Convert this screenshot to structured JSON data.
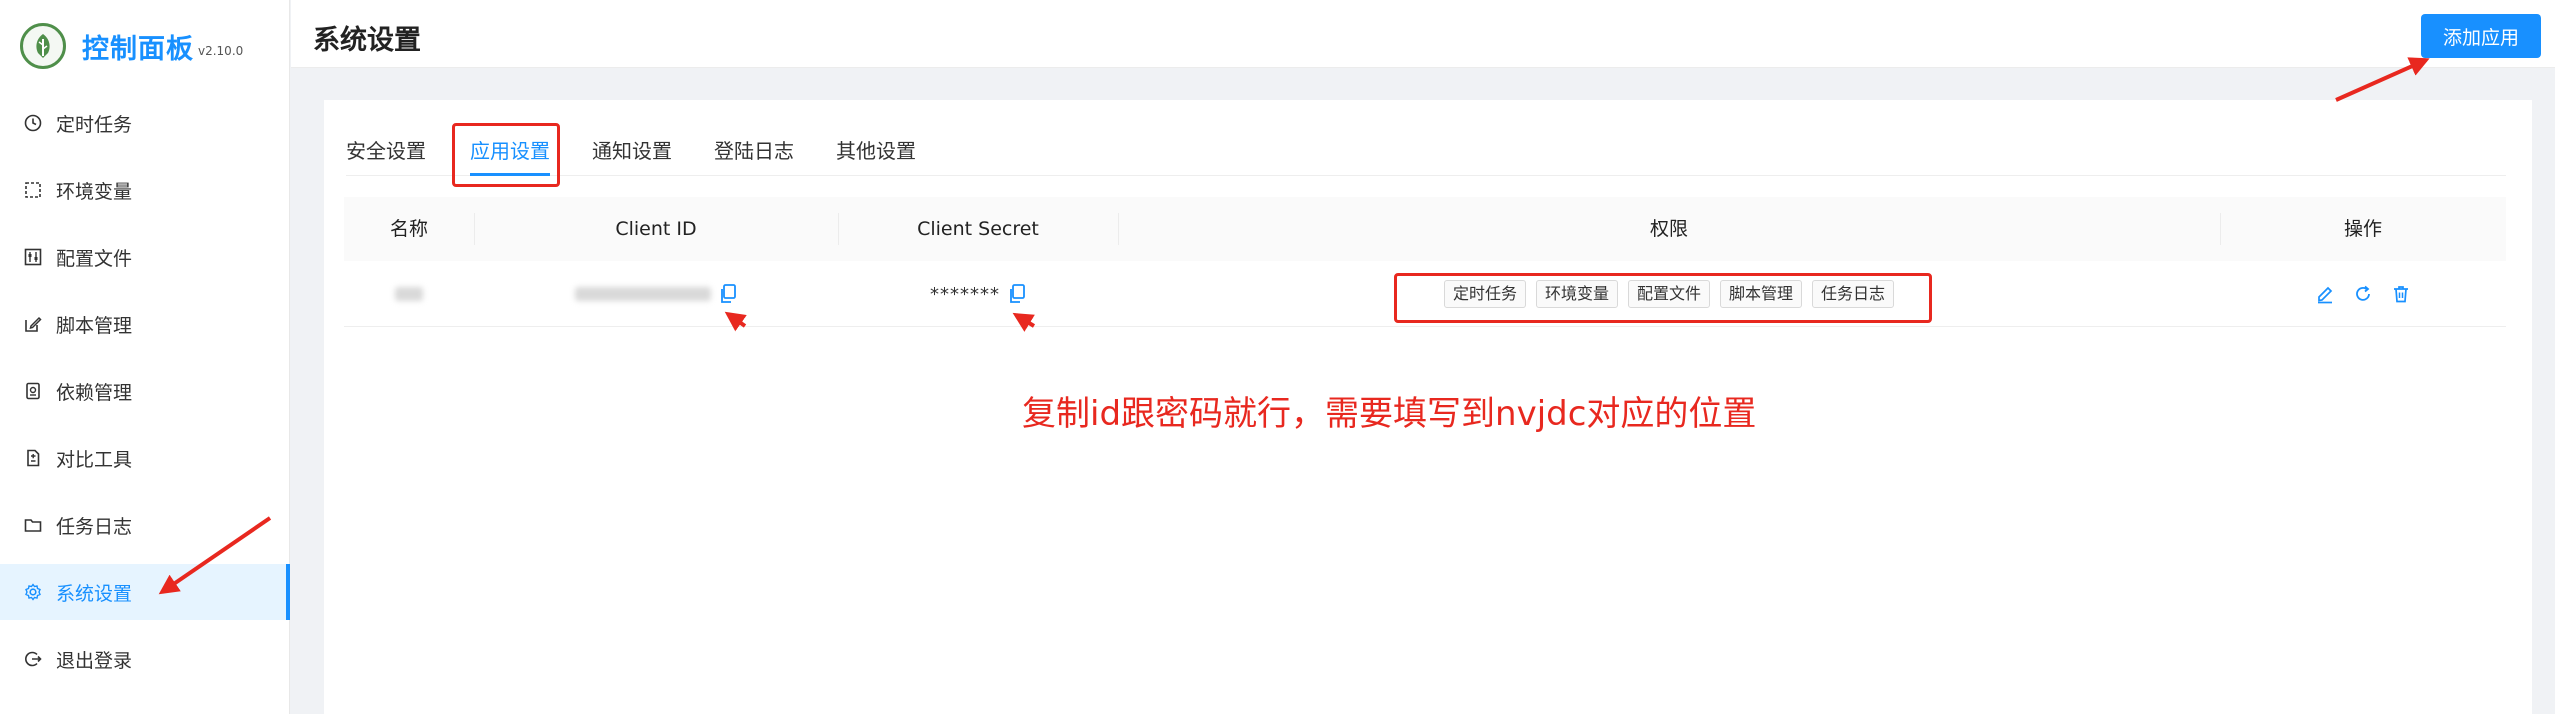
{
  "brand": {
    "title": "控制面板",
    "version": "v2.10.0"
  },
  "sidebar": {
    "items": [
      {
        "label": "定时任务",
        "icon": "clock-icon"
      },
      {
        "label": "环境变量",
        "icon": "dashed-box-icon"
      },
      {
        "label": "配置文件",
        "icon": "sliders-icon"
      },
      {
        "label": "脚本管理",
        "icon": "edit-icon"
      },
      {
        "label": "依赖管理",
        "icon": "package-icon"
      },
      {
        "label": "对比工具",
        "icon": "diff-icon"
      },
      {
        "label": "任务日志",
        "icon": "folder-icon"
      },
      {
        "label": "系统设置",
        "icon": "gear-icon",
        "active": true
      },
      {
        "label": "退出登录",
        "icon": "logout-icon"
      }
    ]
  },
  "header": {
    "title": "系统设置",
    "add_button": "添加应用"
  },
  "tabs": [
    {
      "label": "安全设置"
    },
    {
      "label": "应用设置",
      "active": true
    },
    {
      "label": "通知设置"
    },
    {
      "label": "登陆日志"
    },
    {
      "label": "其他设置"
    }
  ],
  "table": {
    "columns": [
      "名称",
      "Client ID",
      "Client Secret",
      "权限",
      "操作"
    ],
    "rows": [
      {
        "client_secret": "*******",
        "permissions": [
          "定时任务",
          "环境变量",
          "配置文件",
          "脚本管理",
          "任务日志"
        ]
      }
    ]
  },
  "annotation": "复制id跟密码就行，需要填写到nvjdc对应的位置",
  "colors": {
    "accent": "#1890ff",
    "annotation_red": "#e8281f",
    "logo_green": "#4f8f4a"
  }
}
